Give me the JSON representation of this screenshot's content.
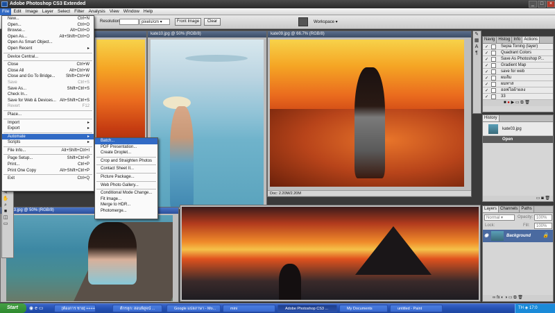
{
  "app": {
    "title": "Adobe Photoshop CS3 Extended"
  },
  "menubar": [
    "File",
    "Edit",
    "Image",
    "Layer",
    "Select",
    "Filter",
    "Analysis",
    "View",
    "Window",
    "Help"
  ],
  "options": {
    "resolution_label": "Resolution:",
    "units": "pixels/cm",
    "front_image": "Front Image",
    "clear": "Clear",
    "workspace": "Workspace"
  },
  "file_menu": [
    {
      "label": "New...",
      "sc": "Ctrl+N"
    },
    {
      "label": "Open...",
      "sc": "Ctrl+O"
    },
    {
      "label": "Browse...",
      "sc": "Alt+Ctrl+O"
    },
    {
      "label": "Open As...",
      "sc": "Alt+Shift+Ctrl+O"
    },
    {
      "label": "Open As Smart Object...",
      "sc": ""
    },
    {
      "label": "Open Recent",
      "sc": "▸"
    },
    {
      "label": "Device Central...",
      "sc": ""
    },
    {
      "label": "Close",
      "sc": "Ctrl+W"
    },
    {
      "label": "Close All",
      "sc": "Alt+Ctrl+W"
    },
    {
      "label": "Close and Go To Bridge...",
      "sc": "Shift+Ctrl+W"
    },
    {
      "label": "Save",
      "sc": "Ctrl+S"
    },
    {
      "label": "Save As...",
      "sc": "Shift+Ctrl+S"
    },
    {
      "label": "Check In...",
      "sc": ""
    },
    {
      "label": "Save for Web & Devices...",
      "sc": "Alt+Shift+Ctrl+S"
    },
    {
      "label": "Revert",
      "sc": "F12"
    },
    {
      "label": "Place...",
      "sc": ""
    },
    {
      "label": "Import",
      "sc": "▸"
    },
    {
      "label": "Export",
      "sc": "▸"
    },
    {
      "label": "Automate",
      "sc": "▸"
    },
    {
      "label": "Scripts",
      "sc": "▸"
    },
    {
      "label": "File Info...",
      "sc": "Alt+Shift+Ctrl+I"
    },
    {
      "label": "Page Setup...",
      "sc": "Shift+Ctrl+P"
    },
    {
      "label": "Print...",
      "sc": "Ctrl+P"
    },
    {
      "label": "Print One Copy",
      "sc": "Alt+Shift+Ctrl+P"
    },
    {
      "label": "Exit",
      "sc": "Ctrl+Q"
    }
  ],
  "automate_menu": [
    "Batch...",
    "PDF Presentation...",
    "Create Droplet...",
    "Crop and Straighten Photos",
    "Contact Sheet II...",
    "Picture Package...",
    "Web Photo Gallery...",
    "Conditional Mode Change...",
    "Fit Image...",
    "Merge to HDR...",
    "Photomerge..."
  ],
  "docs": {
    "doc1": "kate10.jpg @ 50% (RGB/8)",
    "doc2": "kate09.jpg @ 66.7% (RGB/8)",
    "doc3": "kate03.jpg @ 50% (RGB/8)",
    "doc2_status": "Doc: 2.20M/2.20M"
  },
  "actions_panel": {
    "tabs": [
      "Navig",
      "Histog",
      "Info",
      "Actions"
    ],
    "items": [
      "Sepia Toning (layer)",
      "Quadrant Colors",
      "Save As Photoshop P...",
      "Gradient Map",
      "save for web",
      "ผมส้ม",
      "ผมทาส",
      "ออฟโอผ้าผลง",
      "33"
    ]
  },
  "history_panel": {
    "tab": "History",
    "snapshot": "kate03.jpg",
    "step": "Open"
  },
  "layers_panel": {
    "tabs": [
      "Layers",
      "Channels",
      "Paths"
    ],
    "mode": "Normal",
    "opacity_label": "Opacity:",
    "opacity": "100%",
    "lock_label": "Lock:",
    "fill_label": "Fill:",
    "fill": "100%",
    "layer": "Background"
  },
  "taskbar": {
    "start": "Start",
    "tasks": [
      "[ต้องการ ชาย] ++++...",
      "ดีกรหูก: สอนพิสูจน์ ...",
      "Google แปลภาษา - Mo...",
      "mini",
      "Adobe Photoshop CS3 ...",
      "My Documents",
      "untitled - Paint"
    ],
    "lang": "TH",
    "time": "17:0"
  }
}
